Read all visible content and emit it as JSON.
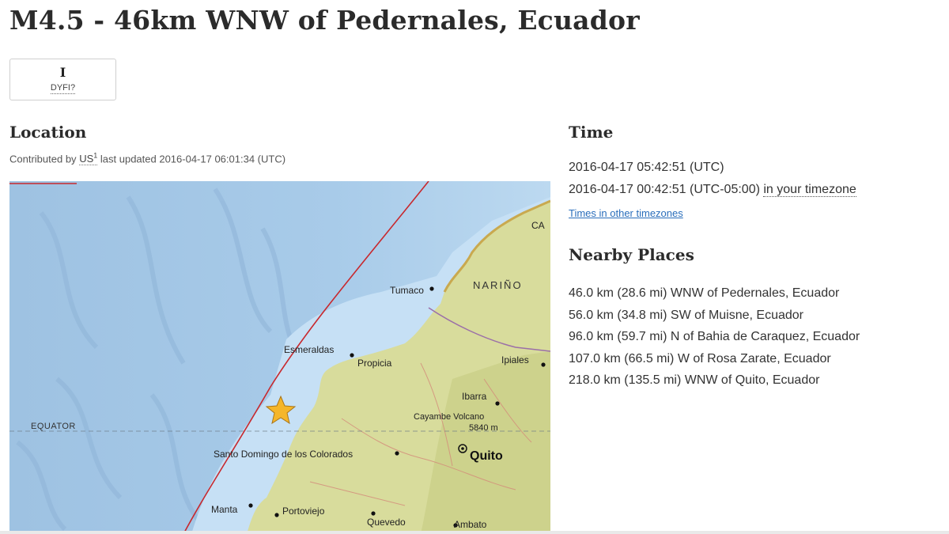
{
  "page": {
    "title": "M4.5 - 46km WNW of Pedernales, Ecuador"
  },
  "dyfi": {
    "value": "I",
    "label": "DYFI?"
  },
  "location": {
    "heading": "Location",
    "contributed_prefix": "Contributed by",
    "network": "US",
    "network_sup": "1",
    "updated_text": "last updated 2016-04-17 06:01:34 (UTC)"
  },
  "map": {
    "equator_label": "EQUATOR",
    "region_label": "NARIÑO",
    "corner_label": "CA",
    "capital": "Quito",
    "places": [
      {
        "key": "tumaco",
        "label": "Tumaco"
      },
      {
        "key": "esmeraldas",
        "label": "Esmeraldas"
      },
      {
        "key": "propicia",
        "label": "Propicia"
      },
      {
        "key": "ipiales",
        "label": "Ipiales"
      },
      {
        "key": "ibarra",
        "label": "Ibarra"
      },
      {
        "key": "cayambe",
        "label": "Cayambe Volcano"
      },
      {
        "key": "cayambe_elev",
        "label": "5840 m"
      },
      {
        "key": "santo_domingo",
        "label": "Santo Domingo de los Colorados"
      },
      {
        "key": "manta",
        "label": "Manta"
      },
      {
        "key": "portoviejo",
        "label": "Portoviejo"
      },
      {
        "key": "quevedo",
        "label": "Quevedo"
      },
      {
        "key": "ambato",
        "label": "Ambato"
      }
    ],
    "epicenter_color": "#f5b62a"
  },
  "time": {
    "heading": "Time",
    "utc": "2016-04-17 05:42:51 (UTC)",
    "local": "2016-04-17 00:42:51 (UTC-05:00)",
    "local_suffix": "in your timezone",
    "other_tz_link": "Times in other timezones"
  },
  "nearby": {
    "heading": "Nearby Places",
    "items": [
      "46.0 km (28.6 mi) WNW of Pedernales, Ecuador",
      "56.0 km (34.8 mi) SW of Muisne, Ecuador",
      "96.0 km (59.7 mi) N of Bahia de Caraquez, Ecuador",
      "107.0 km (66.5 mi) W of Rosa Zarate, Ecuador",
      "218.0 km (135.5 mi) WNW of Quito, Ecuador"
    ]
  },
  "colors": {
    "link": "#2a6ebb",
    "ocean": "#a9cbe8",
    "land": "#d8dc9c",
    "plate_boundary": "#c8282d"
  }
}
